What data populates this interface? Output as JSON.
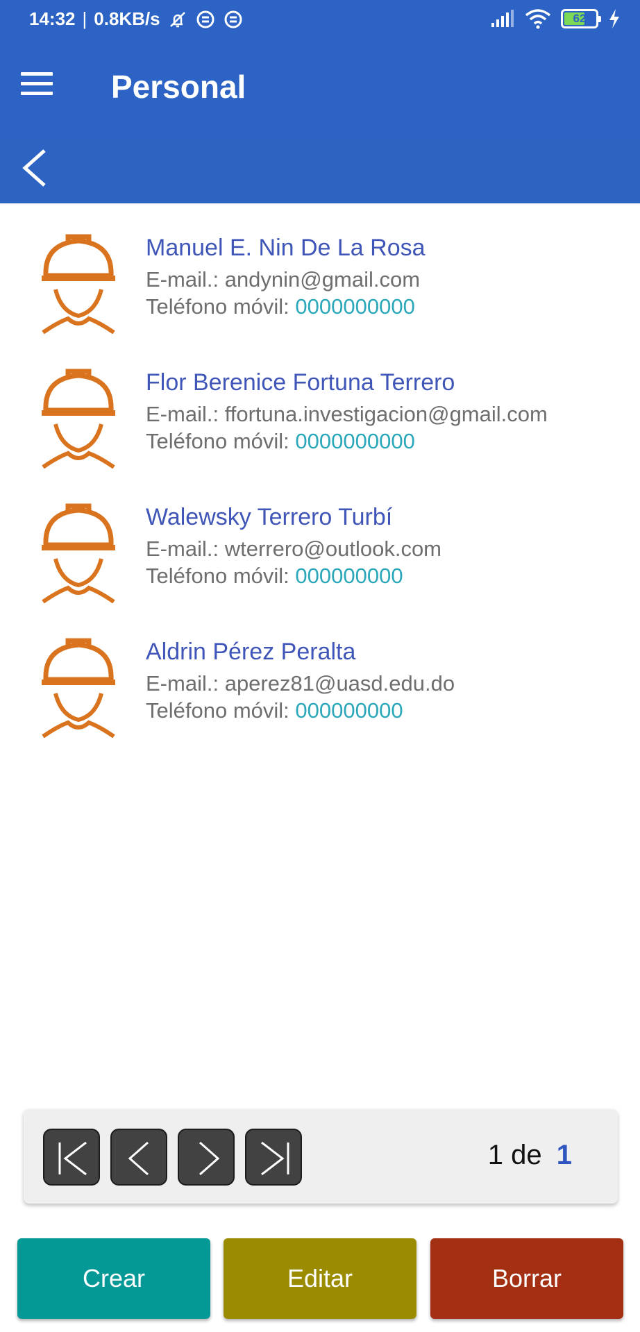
{
  "status_bar": {
    "time": "14:32",
    "network_speed": "0.8KB/s",
    "battery_level": "62"
  },
  "header": {
    "title": "Personal"
  },
  "colors": {
    "app_bar": "#2c63c4",
    "name_text": "#3f55b8",
    "phone_text": "#2aa7b9",
    "avatar_icon": "#d9731e",
    "crear_button": "#049997",
    "editar_button": "#9a8b00",
    "borrar_button": "#a33013"
  },
  "people": [
    {
      "name": "Manuel E. Nin De La Rosa",
      "email_label": "E-mail.:",
      "email": "andynin@gmail.com",
      "phone_label": "Teléfono móvil:",
      "phone": "0000000000",
      "icon": "worker-helmet-icon"
    },
    {
      "name": "Flor Berenice Fortuna Terrero",
      "email_label": "E-mail.:",
      "email": "ffortuna.investigacion@gmail.com",
      "phone_label": "Teléfono móvil:",
      "phone": "0000000000",
      "icon": "worker-helmet-icon"
    },
    {
      "name": "Walewsky Terrero Turbí",
      "email_label": "E-mail.:",
      "email": "wterrero@outlook.com",
      "phone_label": "Teléfono móvil:",
      "phone": "000000000",
      "icon": "worker-helmet-icon"
    },
    {
      "name": "Aldrin Pérez Peralta",
      "email_label": "E-mail.:",
      "email": "aperez81@uasd.edu.do",
      "phone_label": "Teléfono móvil:",
      "phone": "000000000",
      "icon": "worker-helmet-icon"
    }
  ],
  "pagination": {
    "current": "1",
    "separator": "de",
    "total": "1"
  },
  "actions": {
    "crear": "Crear",
    "editar": "Editar",
    "borrar": "Borrar"
  }
}
